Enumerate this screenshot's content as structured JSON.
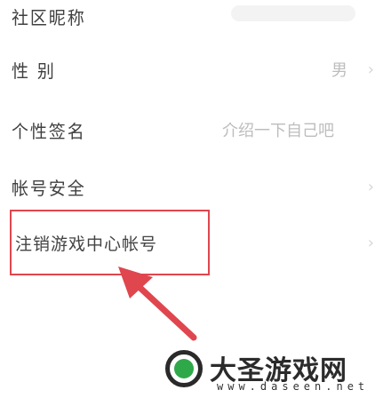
{
  "profile": {
    "items": [
      {
        "label": "社区昵称",
        "value": ""
      },
      {
        "label": "性 别",
        "value": "男"
      },
      {
        "label": "个性签名",
        "value": "介绍一下自己吧"
      },
      {
        "label": "帐号安全",
        "value": ""
      }
    ],
    "highlighted_item": {
      "label": "注销游戏中心帐号"
    }
  },
  "colors": {
    "highlight": "#e0464e",
    "arrow": "#e0464e"
  },
  "watermark": {
    "title": "大圣游戏网",
    "url": "www.daseen.net"
  }
}
